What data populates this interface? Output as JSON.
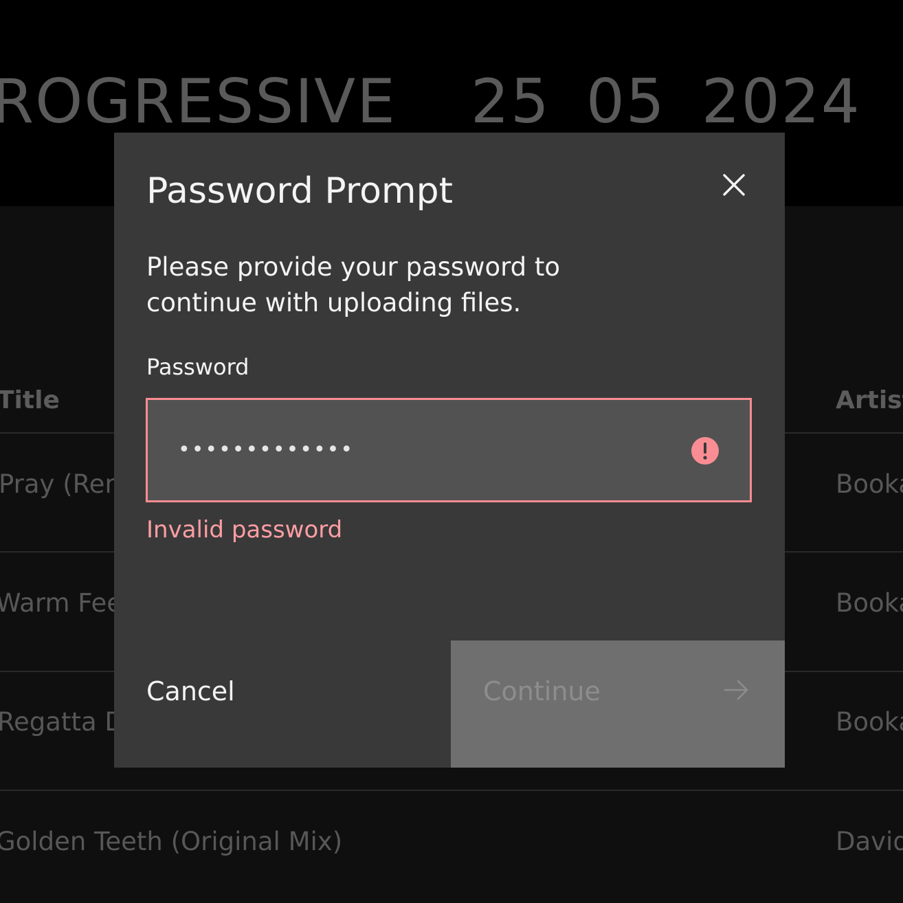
{
  "background": {
    "event_name": "ROGRESSIVE",
    "date_parts": [
      "25",
      "05",
      "2024"
    ],
    "table": {
      "columns": [
        "Title",
        "Artist"
      ],
      "rows": [
        {
          "title": "Pray (Rem",
          "artist": "Booka"
        },
        {
          "title": "Warm Fee",
          "artist": "Booka"
        },
        {
          "title": "Regatta D",
          "artist": "Booka"
        },
        {
          "title": "Golden Teeth (Original Mix)",
          "artist": "David"
        }
      ]
    }
  },
  "modal": {
    "title": "Password Prompt",
    "close_icon": "close-icon",
    "description": "Please provide your password to continue with uploading files.",
    "field_label": "Password",
    "password_masked": "•••••••••••••",
    "error_icon": "warning-filled-icon",
    "error_text": "Invalid password",
    "cancel_label": "Cancel",
    "continue_label": "Continue",
    "continue_icon": "arrow-right-icon",
    "colors": {
      "modal_bg": "#393939",
      "field_bg": "#525252",
      "error": "#fa8d93",
      "continue_bg_disabled": "#6f6f6f"
    }
  }
}
